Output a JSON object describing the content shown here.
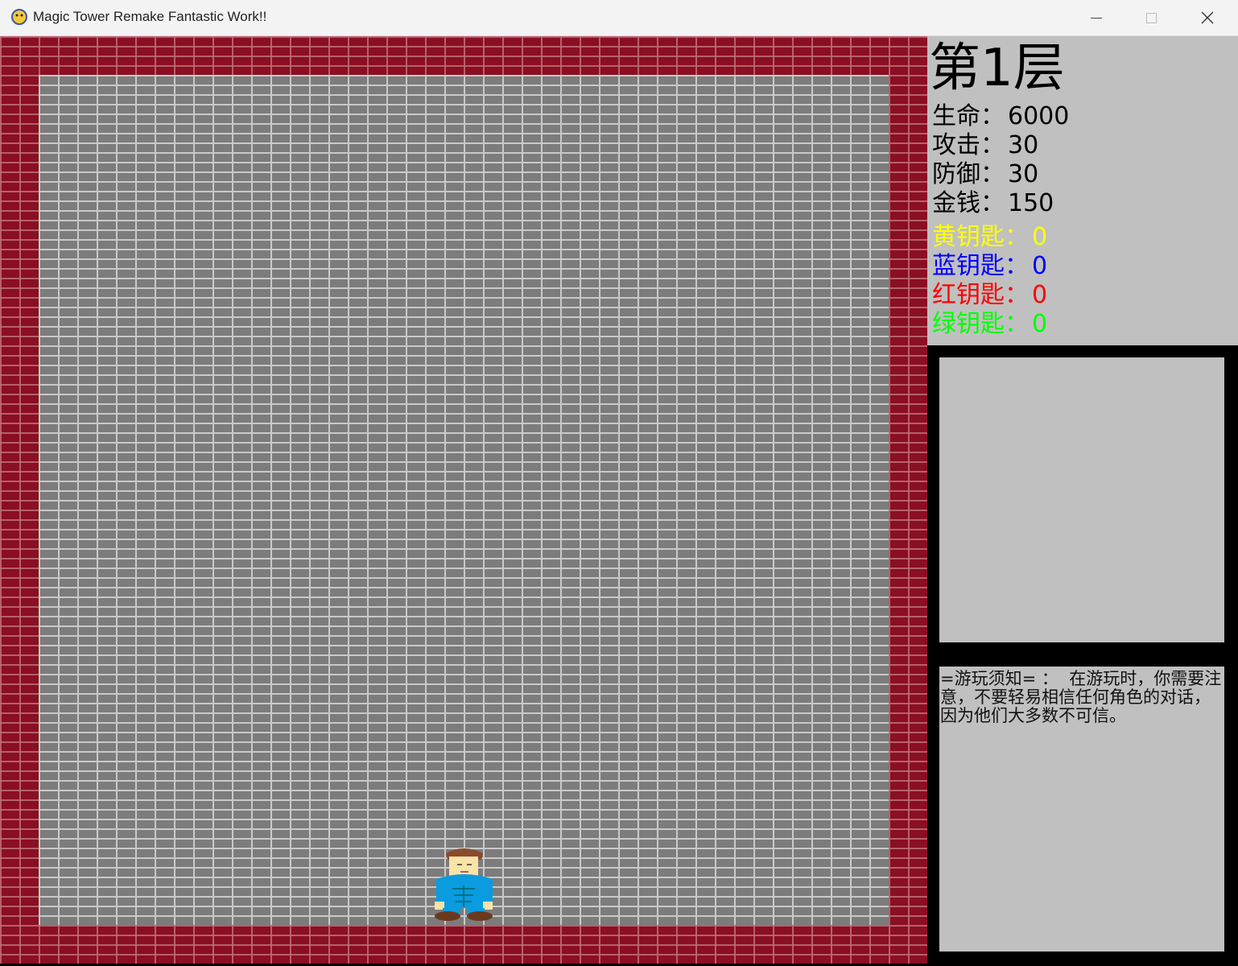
{
  "window": {
    "title": "Magic Tower Remake Fantastic Work!!",
    "icon": "pygame-snake-icon"
  },
  "status": {
    "floor_label": "第1层",
    "stats": [
      {
        "label": "生命：",
        "value": "6000",
        "color": "#000000"
      },
      {
        "label": "攻击：",
        "value": "30",
        "color": "#000000"
      },
      {
        "label": "防御：",
        "value": "30",
        "color": "#000000"
      },
      {
        "label": "金钱：",
        "value": "150",
        "color": "#000000"
      }
    ],
    "keys": [
      {
        "label": "黄钥匙：",
        "value": "0",
        "color": "#ffff00"
      },
      {
        "label": "蓝钥匙：",
        "value": "0",
        "color": "#0000ff"
      },
      {
        "label": "红钥匙：",
        "value": "0",
        "color": "#ff0000"
      },
      {
        "label": "绿钥匙：",
        "value": "0",
        "color": "#00ff00"
      }
    ]
  },
  "message": {
    "text": "=游玩须知= ：  在游玩时，你需要注意，不要轻易相信任何角色的对话，因为他们大多数不可信。"
  },
  "colors": {
    "wall": "#8a0f22",
    "floor": "#7c7c7c",
    "panel": "#c0c0c0"
  }
}
